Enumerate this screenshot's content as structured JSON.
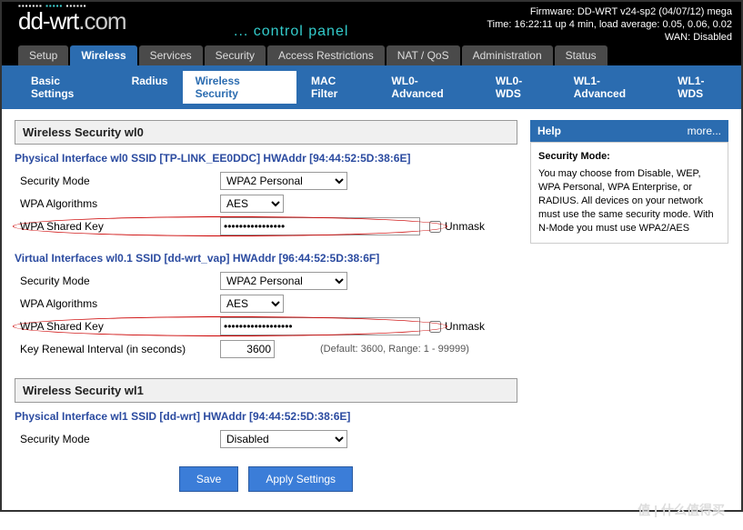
{
  "header": {
    "logo_main": "dd-wrt",
    "logo_suffix": ".com",
    "subtitle": "... control panel",
    "firmware": "Firmware: DD-WRT v24-sp2 (04/07/12) mega",
    "time": "Time: 16:22:11 up 4 min, load average: 0.05, 0.06, 0.02",
    "wan": "WAN: Disabled"
  },
  "maintabs": [
    "Setup",
    "Wireless",
    "Services",
    "Security",
    "Access Restrictions",
    "NAT / QoS",
    "Administration",
    "Status"
  ],
  "maintabs_active": 1,
  "subtabs": [
    "Basic Settings",
    "Radius",
    "Wireless Security",
    "MAC Filter",
    "WL0-Advanced",
    "WL0-WDS",
    "WL1-Advanced",
    "WL1-WDS"
  ],
  "subtabs_active": 2,
  "sections": {
    "wl0_title": "Wireless Security wl0",
    "wl0_phys": "Physical Interface wl0 SSID [TP-LINK_EE0DDC] HWAddr [94:44:52:5D:38:6E]",
    "wl0_virt": "Virtual Interfaces wl0.1 SSID [dd-wrt_vap] HWAddr [96:44:52:5D:38:6F]",
    "wl1_title": "Wireless Security wl1",
    "wl1_phys": "Physical Interface wl1 SSID [dd-wrt] HWAddr [94:44:52:5D:38:6E]"
  },
  "labels": {
    "sec_mode": "Security Mode",
    "wpa_alg": "WPA Algorithms",
    "wpa_key": "WPA Shared Key",
    "key_renew": "Key Renewal Interval (in seconds)",
    "unmask": "Unmask",
    "default_range": "(Default: 3600, Range: 1 - 99999)"
  },
  "values": {
    "wl0_phys_mode": "WPA2 Personal",
    "wl0_phys_alg": "AES",
    "wl0_phys_key": "••••••••••••••••",
    "wl0_virt_mode": "WPA2 Personal",
    "wl0_virt_alg": "AES",
    "wl0_virt_key": "••••••••••••••••••",
    "wl0_virt_renew": "3600",
    "wl1_mode": "Disabled"
  },
  "help": {
    "title": "Help",
    "more": "more...",
    "heading": "Security Mode:",
    "body": "You may choose from Disable, WEP, WPA Personal, WPA Enterprise, or RADIUS. All devices on your network must use the same security mode. With N-Mode you must use WPA2/AES"
  },
  "buttons": {
    "save": "Save",
    "apply": "Apply Settings"
  },
  "watermark": "值 | 什么值得买"
}
